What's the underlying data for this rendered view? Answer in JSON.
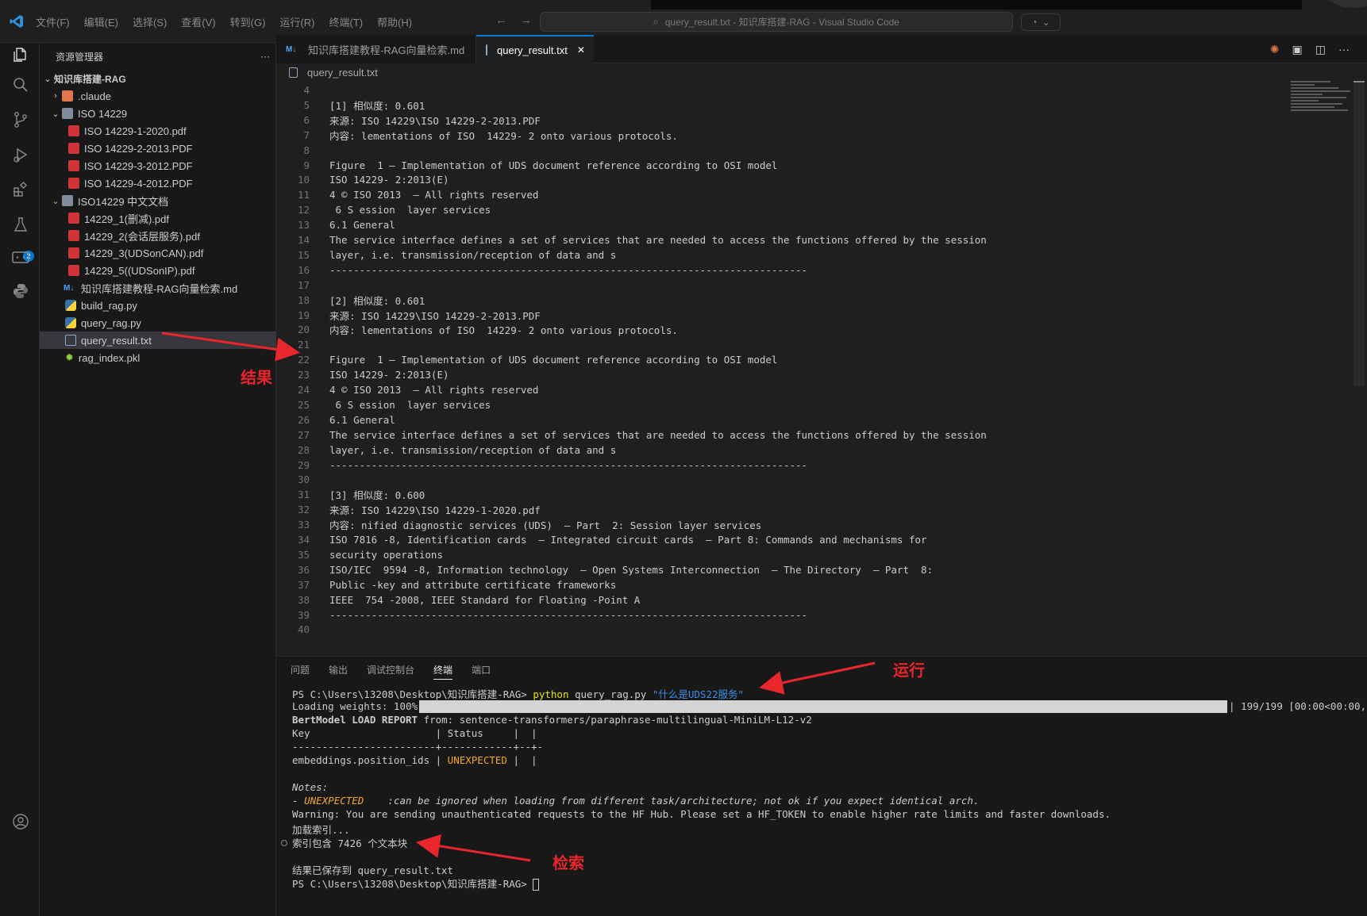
{
  "titlebar": {
    "menu": [
      "文件(F)",
      "编辑(E)",
      "选择(S)",
      "查看(V)",
      "转到(G)",
      "运行(R)",
      "终端(T)",
      "帮助(H)"
    ],
    "search_text": "query_result.txt - 知识库搭建-RAG - Visual Studio Code"
  },
  "sidebar": {
    "title": "资源管理器",
    "more": "···",
    "root": "知识库搭建-RAG",
    "items": [
      {
        "label": ".claude",
        "type": "folder-closed",
        "depth": 1
      },
      {
        "label": "ISO 14229",
        "type": "folder-open",
        "depth": 1
      },
      {
        "label": "ISO 14229-1-2020.pdf",
        "type": "pdf",
        "depth": 2
      },
      {
        "label": "ISO 14229-2-2013.PDF",
        "type": "pdf",
        "depth": 2
      },
      {
        "label": "ISO 14229-3-2012.PDF",
        "type": "pdf",
        "depth": 2
      },
      {
        "label": "ISO 14229-4-2012.PDF",
        "type": "pdf",
        "depth": 2
      },
      {
        "label": "ISO14229 中文文档",
        "type": "folder-open",
        "depth": 1
      },
      {
        "label": "14229_1(删减).pdf",
        "type": "pdf",
        "depth": 2
      },
      {
        "label": "14229_2(会话层服务).pdf",
        "type": "pdf",
        "depth": 2
      },
      {
        "label": "14229_3(UDSonCAN).pdf",
        "type": "pdf",
        "depth": 2
      },
      {
        "label": "14229_5((UDSonIP).pdf",
        "type": "pdf",
        "depth": 2
      },
      {
        "label": "知识库搭建教程-RAG向量检索.md",
        "type": "md",
        "depth": 1
      },
      {
        "label": "build_rag.py",
        "type": "py",
        "depth": 1
      },
      {
        "label": "query_rag.py",
        "type": "py",
        "depth": 1
      },
      {
        "label": "query_result.txt",
        "type": "txt",
        "depth": 1
      },
      {
        "label": "rag_index.pkl",
        "type": "pkl",
        "depth": 1
      }
    ]
  },
  "tabs": [
    {
      "label": "知识库搭建教程-RAG向量检索.md",
      "prefix": "M↓"
    },
    {
      "label": "query_result.txt",
      "close": "✕"
    }
  ],
  "breadcrumb": "query_result.txt",
  "editor": {
    "lines": [
      {
        "n": "4",
        "t": ""
      },
      {
        "n": "5",
        "t": "[1] 相似度: 0.601"
      },
      {
        "n": "6",
        "t": "来源: ISO 14229\\ISO 14229-2-2013.PDF"
      },
      {
        "n": "7",
        "t": "内容: lementations of ISO  14229- 2 onto various protocols."
      },
      {
        "n": "8",
        "t": ""
      },
      {
        "n": "9",
        "t": "Figure  1 — Implementation of UDS document reference according to OSI model"
      },
      {
        "n": "10",
        "t": "ISO 14229- 2:2013(E)"
      },
      {
        "n": "11",
        "t": "4 © ISO 2013  – All rights reserved"
      },
      {
        "n": "12",
        "t": " 6 S ession  layer services"
      },
      {
        "n": "13",
        "t": "6.1 General"
      },
      {
        "n": "14",
        "t": "The service interface defines a set of services that are needed to access the functions offered by the session"
      },
      {
        "n": "15",
        "t": "layer, i.e. transmission/reception of data and s"
      },
      {
        "n": "16",
        "t": "--------------------------------------------------------------------------------"
      },
      {
        "n": "17",
        "t": ""
      },
      {
        "n": "18",
        "t": "[2] 相似度: 0.601"
      },
      {
        "n": "19",
        "t": "来源: ISO 14229\\ISO 14229-2-2013.PDF"
      },
      {
        "n": "20",
        "t": "内容: lementations of ISO  14229- 2 onto various protocols."
      },
      {
        "n": "21",
        "t": ""
      },
      {
        "n": "22",
        "t": "Figure  1 — Implementation of UDS document reference according to OSI model"
      },
      {
        "n": "23",
        "t": "ISO 14229- 2:2013(E)"
      },
      {
        "n": "24",
        "t": "4 © ISO 2013  – All rights reserved"
      },
      {
        "n": "25",
        "t": " 6 S ession  layer services"
      },
      {
        "n": "26",
        "t": "6.1 General"
      },
      {
        "n": "27",
        "t": "The service interface defines a set of services that are needed to access the functions offered by the session"
      },
      {
        "n": "28",
        "t": "layer, i.e. transmission/reception of data and s"
      },
      {
        "n": "29",
        "t": "--------------------------------------------------------------------------------"
      },
      {
        "n": "30",
        "t": ""
      },
      {
        "n": "31",
        "t": "[3] 相似度: 0.600"
      },
      {
        "n": "32",
        "t": "来源: ISO 14229\\ISO 14229-1-2020.pdf"
      },
      {
        "n": "33",
        "t": "内容: nified diagnostic services (UDS)  — Part  2: Session layer services"
      },
      {
        "n": "34",
        "t": "ISO 7816 -8, Identification cards  — Integrated circuit cards  — Part 8: Commands and mechanisms for"
      },
      {
        "n": "35",
        "t": "security operations"
      },
      {
        "n": "36",
        "t": "ISO/IEC  9594 -8, Information technology  — Open Systems Interconnection  — The Directory  — Part  8:"
      },
      {
        "n": "37",
        "t": "Public -key and attribute certificate frameworks"
      },
      {
        "n": "38",
        "t": "IEEE  754 -2008, IEEE Standard for Floating -Point A"
      },
      {
        "n": "39",
        "t": "--------------------------------------------------------------------------------"
      },
      {
        "n": "40",
        "t": ""
      }
    ]
  },
  "panel": {
    "tabs": [
      "问题",
      "输出",
      "调试控制台",
      "终端",
      "端口"
    ],
    "active_tab": "终端",
    "terminal": {
      "prompt1": "PS C:\\Users\\13208\\Desktop\\知识库搭建-RAG> ",
      "cmd": "python",
      "cmd_args": " query_rag.py ",
      "cmd_str": "\"什么是UDS22服务\"",
      "loading_label": "Loading weights: 100%|",
      "loading_tail": "| 199/199 [00:00<00:00,",
      "bert_bold": "BertModel LOAD REPORT",
      "bert_rest": " from: sentence-transformers/paraphrase-multilingual-MiniLM-L12-v2",
      "table_header": "Key                     | Status     |  |",
      "table_sep": "------------------------+------------+--+-",
      "row_key": "embeddings.position_ids | ",
      "row_status": "UNEXPECTED",
      "row_tail": " |  |",
      "notes": "Notes:",
      "note_dash": "- ",
      "note_unexpected": "UNEXPECTED",
      "note_rest": "    :can be ignored when loading from different task/architecture; not ok if you expect identical arch.",
      "warning": "Warning: You are sending unauthenticated requests to the HF Hub. Please set a HF_TOKEN to enable higher rate limits and faster downloads.",
      "loading_index": "加载索引...",
      "index_count": "索引包含 7426 个文本块",
      "saved": "结果已保存到 query_result.txt",
      "prompt2": "PS C:\\Users\\13208\\Desktop\\知识库搭建-RAG> "
    }
  },
  "annotations": {
    "result": "结果",
    "run": "运行",
    "search": "检索"
  },
  "colors": {
    "accent": "#0078d4",
    "annotation": "#e8262b",
    "cmd_yellow": "#e5e510",
    "string_blue": "#3b8eea",
    "warn_orange": "#f5a623"
  }
}
